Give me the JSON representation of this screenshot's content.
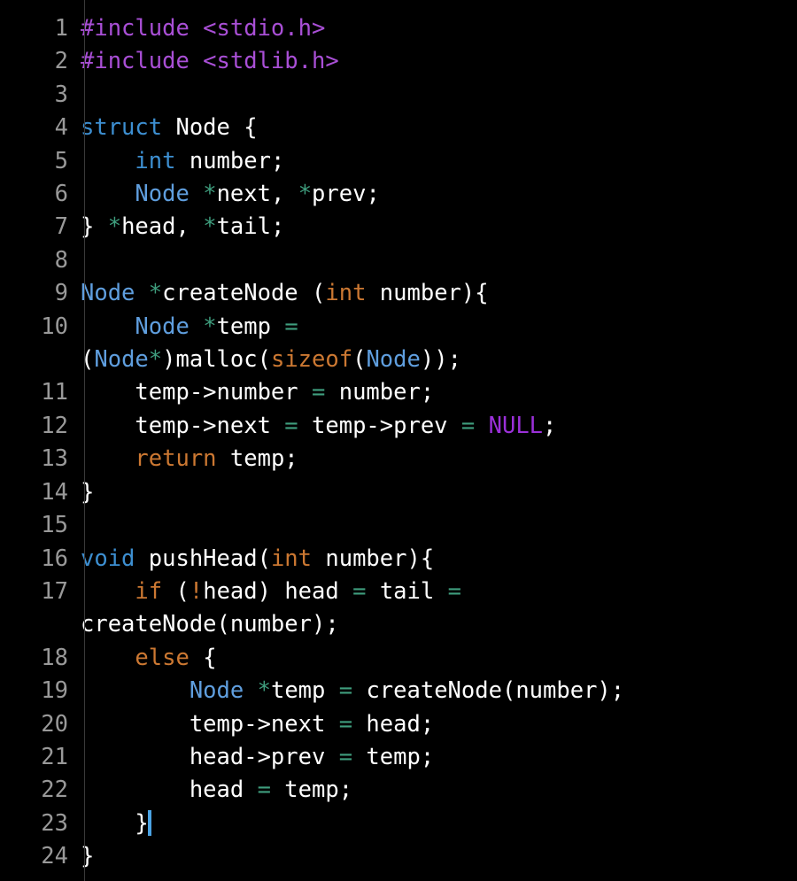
{
  "editor": {
    "language": "C",
    "background_color": "#000000",
    "gutter_color": "#999999",
    "gutter_rule_color": "#3a3a3a",
    "default_text_color": "#ffffff",
    "caret_color": "#4ba3e3",
    "caret_line": 23,
    "total_lines": 24,
    "word_wrap": true
  },
  "palette": {
    "preprocessor": "#a94fd6",
    "keyword": "#3d8fd1",
    "type": "#5f9ede",
    "control_keyword": "#cc7832",
    "operator": "#3f9e7e",
    "constant": "#9b30d9",
    "plain": "#ffffff"
  },
  "lines": [
    {
      "n": "1",
      "text": "#include <stdio.h>"
    },
    {
      "n": "2",
      "text": "#include <stdlib.h>"
    },
    {
      "n": "3",
      "text": ""
    },
    {
      "n": "4",
      "text": "struct Node {"
    },
    {
      "n": "5",
      "text": "    int number;"
    },
    {
      "n": "6",
      "text": "    Node *next, *prev;"
    },
    {
      "n": "7",
      "text": "} *head, *tail;"
    },
    {
      "n": "8",
      "text": ""
    },
    {
      "n": "9",
      "text": "Node *createNode (int number){"
    },
    {
      "n": "10",
      "text": "    Node *temp = (Node*)malloc(sizeof(Node));"
    },
    {
      "n": "10w",
      "text": "(Node*)malloc(sizeof(Node));"
    },
    {
      "n": "11",
      "text": "    temp->number = number;"
    },
    {
      "n": "12",
      "text": "    temp->next = temp->prev = NULL;"
    },
    {
      "n": "13",
      "text": "    return temp;"
    },
    {
      "n": "14",
      "text": "}"
    },
    {
      "n": "15",
      "text": ""
    },
    {
      "n": "16",
      "text": "void pushHead(int number){"
    },
    {
      "n": "17",
      "text": "    if (!head) head = tail = createNode(number);"
    },
    {
      "n": "17w",
      "text": "createNode(number);"
    },
    {
      "n": "18",
      "text": "    else {"
    },
    {
      "n": "19",
      "text": "        Node *temp = createNode(number);"
    },
    {
      "n": "20",
      "text": "        temp->next = head;"
    },
    {
      "n": "21",
      "text": "        head->prev = temp;"
    },
    {
      "n": "22",
      "text": "        head = temp;"
    },
    {
      "n": "23",
      "text": "    }"
    },
    {
      "n": "24",
      "text": "}"
    }
  ],
  "gutter": {
    "numbers": [
      "1",
      "2",
      "3",
      "4",
      "5",
      "6",
      "7",
      "8",
      "9",
      "10",
      "11",
      "12",
      "13",
      "14",
      "15",
      "16",
      "17",
      "18",
      "19",
      "20",
      "21",
      "22",
      "23",
      "24"
    ]
  },
  "tokens": {
    "l1": [
      {
        "t": "#include <stdio.h>",
        "c": "t-pre"
      }
    ],
    "l2": [
      {
        "t": "#include <stdlib.h>",
        "c": "t-pre"
      }
    ],
    "l3": [],
    "l4": [
      {
        "t": "struct",
        "c": "t-kw"
      },
      {
        "t": " Node {",
        "c": "t-plain"
      }
    ],
    "l5": [
      {
        "t": "    ",
        "c": "t-plain"
      },
      {
        "t": "int",
        "c": "t-kw"
      },
      {
        "t": " number;",
        "c": "t-plain"
      }
    ],
    "l6": [
      {
        "t": "    ",
        "c": "t-plain"
      },
      {
        "t": "Node",
        "c": "t-type"
      },
      {
        "t": " ",
        "c": "t-plain"
      },
      {
        "t": "*",
        "c": "t-op"
      },
      {
        "t": "next, ",
        "c": "t-plain"
      },
      {
        "t": "*",
        "c": "t-op"
      },
      {
        "t": "prev;",
        "c": "t-plain"
      }
    ],
    "l7": [
      {
        "t": "} ",
        "c": "t-plain"
      },
      {
        "t": "*",
        "c": "t-op"
      },
      {
        "t": "head, ",
        "c": "t-plain"
      },
      {
        "t": "*",
        "c": "t-op"
      },
      {
        "t": "tail;",
        "c": "t-plain"
      }
    ],
    "l8": [],
    "l9": [
      {
        "t": "Node",
        "c": "t-type"
      },
      {
        "t": " ",
        "c": "t-plain"
      },
      {
        "t": "*",
        "c": "t-op"
      },
      {
        "t": "createNode (",
        "c": "t-plain"
      },
      {
        "t": "int",
        "c": "t-ctl"
      },
      {
        "t": " number){",
        "c": "t-plain"
      }
    ],
    "l10": [
      {
        "t": "    ",
        "c": "t-plain"
      },
      {
        "t": "Node",
        "c": "t-type"
      },
      {
        "t": " ",
        "c": "t-plain"
      },
      {
        "t": "*",
        "c": "t-op"
      },
      {
        "t": "temp ",
        "c": "t-plain"
      },
      {
        "t": "=",
        "c": "t-op"
      },
      {
        "t": " ",
        "c": "t-plain"
      }
    ],
    "l10w": [
      {
        "t": "(",
        "c": "t-plain"
      },
      {
        "t": "Node",
        "c": "t-type"
      },
      {
        "t": "*",
        "c": "t-op"
      },
      {
        "t": ")malloc(",
        "c": "t-plain"
      },
      {
        "t": "sizeof",
        "c": "t-ctl"
      },
      {
        "t": "(",
        "c": "t-plain"
      },
      {
        "t": "Node",
        "c": "t-type"
      },
      {
        "t": "));",
        "c": "t-plain"
      }
    ],
    "l11": [
      {
        "t": "    temp->number ",
        "c": "t-plain"
      },
      {
        "t": "=",
        "c": "t-op"
      },
      {
        "t": " number;",
        "c": "t-plain"
      }
    ],
    "l12": [
      {
        "t": "    temp->next ",
        "c": "t-plain"
      },
      {
        "t": "=",
        "c": "t-op"
      },
      {
        "t": " temp->prev ",
        "c": "t-plain"
      },
      {
        "t": "=",
        "c": "t-op"
      },
      {
        "t": " ",
        "c": "t-plain"
      },
      {
        "t": "NULL",
        "c": "t-const"
      },
      {
        "t": ";",
        "c": "t-plain"
      }
    ],
    "l13": [
      {
        "t": "    ",
        "c": "t-plain"
      },
      {
        "t": "return",
        "c": "t-ctl"
      },
      {
        "t": " temp;",
        "c": "t-plain"
      }
    ],
    "l14": [
      {
        "t": "}",
        "c": "t-plain"
      }
    ],
    "l15": [],
    "l16": [
      {
        "t": "void",
        "c": "t-kw"
      },
      {
        "t": " pushHead(",
        "c": "t-plain"
      },
      {
        "t": "int",
        "c": "t-ctl"
      },
      {
        "t": " number){",
        "c": "t-plain"
      }
    ],
    "l17": [
      {
        "t": "    ",
        "c": "t-plain"
      },
      {
        "t": "if",
        "c": "t-ctl"
      },
      {
        "t": " (",
        "c": "t-plain"
      },
      {
        "t": "!",
        "c": "t-ctl"
      },
      {
        "t": "head) head ",
        "c": "t-plain"
      },
      {
        "t": "=",
        "c": "t-op"
      },
      {
        "t": " tail ",
        "c": "t-plain"
      },
      {
        "t": "=",
        "c": "t-op"
      },
      {
        "t": " ",
        "c": "t-plain"
      }
    ],
    "l17w": [
      {
        "t": "createNode(number);",
        "c": "t-plain"
      }
    ],
    "l18": [
      {
        "t": "    ",
        "c": "t-plain"
      },
      {
        "t": "else",
        "c": "t-ctl"
      },
      {
        "t": " {",
        "c": "t-plain"
      }
    ],
    "l19": [
      {
        "t": "        ",
        "c": "t-plain"
      },
      {
        "t": "Node",
        "c": "t-type"
      },
      {
        "t": " ",
        "c": "t-plain"
      },
      {
        "t": "*",
        "c": "t-op"
      },
      {
        "t": "temp ",
        "c": "t-plain"
      },
      {
        "t": "=",
        "c": "t-op"
      },
      {
        "t": " createNode(number);",
        "c": "t-plain"
      }
    ],
    "l20": [
      {
        "t": "        temp->next ",
        "c": "t-plain"
      },
      {
        "t": "=",
        "c": "t-op"
      },
      {
        "t": " head;",
        "c": "t-plain"
      }
    ],
    "l21": [
      {
        "t": "        head->prev ",
        "c": "t-plain"
      },
      {
        "t": "=",
        "c": "t-op"
      },
      {
        "t": " temp;",
        "c": "t-plain"
      }
    ],
    "l22": [
      {
        "t": "        head ",
        "c": "t-plain"
      },
      {
        "t": "=",
        "c": "t-op"
      },
      {
        "t": " temp;",
        "c": "t-plain"
      }
    ],
    "l23": [
      {
        "t": "    }",
        "c": "t-plain"
      }
    ],
    "l24": [
      {
        "t": "}",
        "c": "t-plain"
      }
    ]
  }
}
